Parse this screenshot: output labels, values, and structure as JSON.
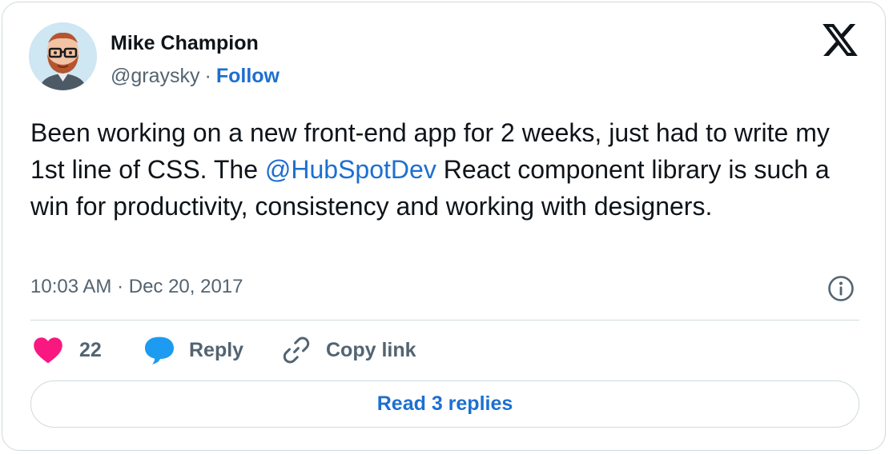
{
  "author": {
    "name": "Mike Champion",
    "handle": "@graysky",
    "separator": "·",
    "follow_label": "Follow"
  },
  "tweet": {
    "text_part1": "Been working on a new front-end app for 2 weeks, just had to write my 1st line of CSS. The ",
    "mention": "@HubSpotDev",
    "text_part2": " React component library is such a win for productivity, consistency and working with designers."
  },
  "meta": {
    "timestamp": "10:03 AM · Dec 20, 2017"
  },
  "actions": {
    "like_count": "22",
    "reply_label": "Reply",
    "copy_link_label": "Copy link"
  },
  "footer": {
    "read_replies_label": "Read 3 replies"
  },
  "colors": {
    "accent": "#1d6fd0",
    "heart": "#f91880",
    "text_primary": "#0f1419",
    "text_secondary": "#536471",
    "border": "#cfd9de"
  },
  "icons": {
    "avatar": "bitmoji-avatar",
    "brand": "x-logo-icon",
    "info": "info-icon",
    "like": "heart-icon",
    "reply": "speech-bubble-icon",
    "copy": "link-icon"
  }
}
